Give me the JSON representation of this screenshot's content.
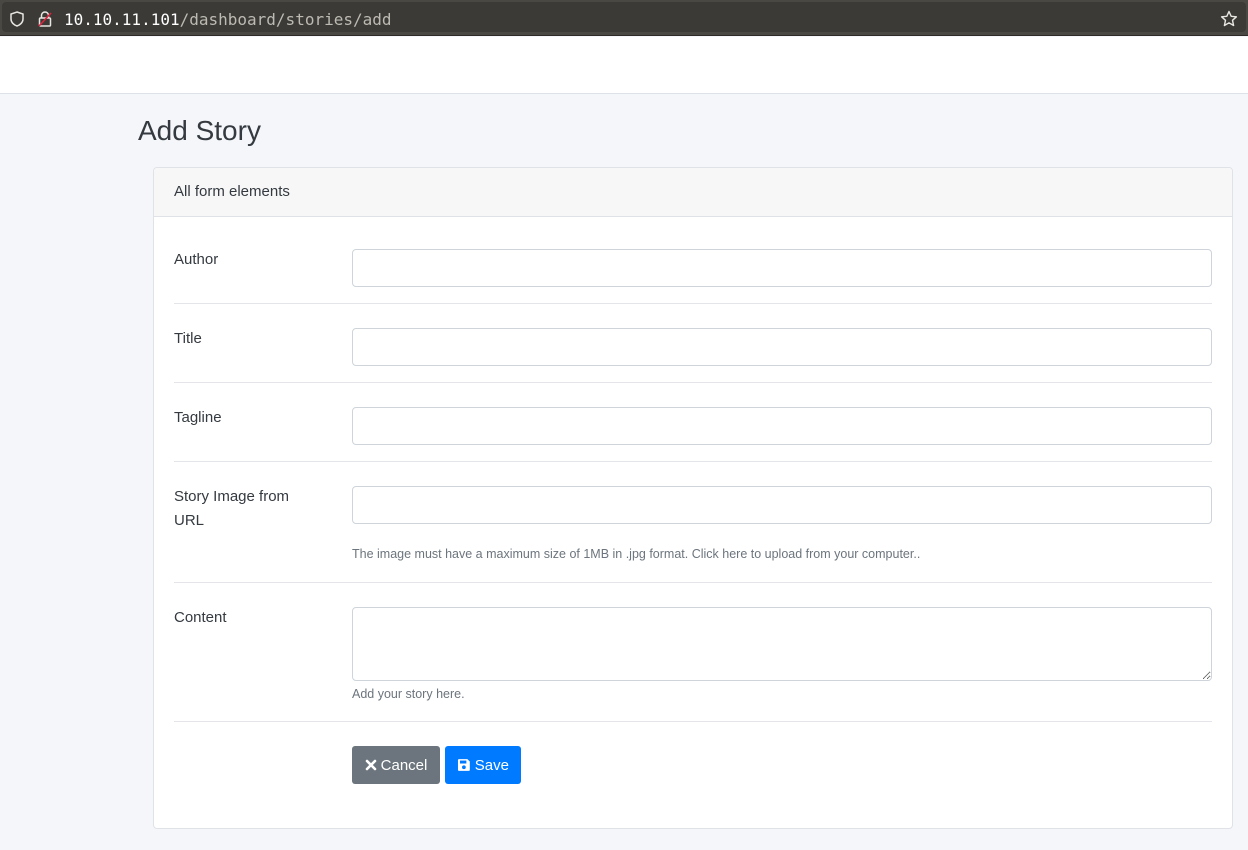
{
  "browser": {
    "url_host": "10.10.11.101",
    "url_path": "/dashboard/stories/add"
  },
  "page": {
    "title": "Add Story"
  },
  "card": {
    "header": "All form elements"
  },
  "form": {
    "author_label": "Author",
    "author_value": "",
    "title_label": "Title",
    "title_value": "",
    "tagline_label": "Tagline",
    "tagline_value": "",
    "image_label": "Story Image from URL",
    "image_value": "",
    "image_help": "The image must have a maximum size of 1MB in .jpg format. Click here to upload from your computer..",
    "content_label": "Content",
    "content_value": "",
    "content_help": "Add your story here."
  },
  "buttons": {
    "cancel_label": "Cancel",
    "cancel_icon": "times-icon",
    "save_label": "Save",
    "save_icon": "floppy-disk-icon"
  },
  "colors": {
    "primary": "#007bff",
    "secondary": "#6c757d",
    "background": "#f4f6f9"
  }
}
